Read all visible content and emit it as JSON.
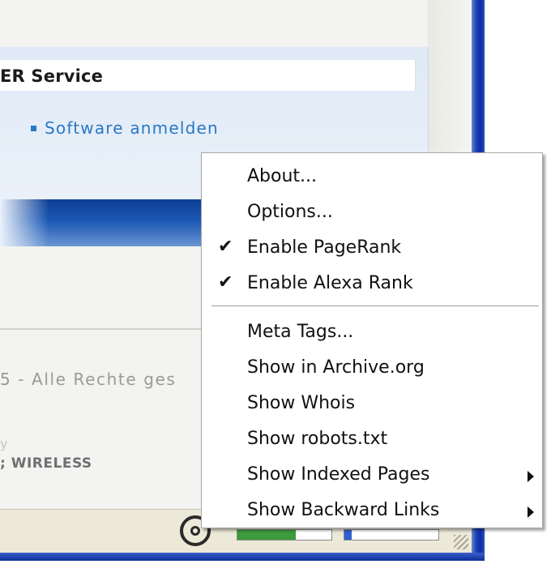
{
  "page": {
    "service_header": "ER Service",
    "service_link": "Software anmelden",
    "copyright": "5 - Alle Rechte ges",
    "by_text": "y",
    "wireless_logo": "; WIRELESS"
  },
  "status_bar": {
    "pagerank_level": 0.62,
    "alexa_level": 0.08
  },
  "context_menu": {
    "items": [
      {
        "label": "About...",
        "checked": false,
        "submenu": false
      },
      {
        "label": "Options...",
        "checked": false,
        "submenu": false
      },
      {
        "label": "Enable PageRank",
        "checked": true,
        "submenu": false
      },
      {
        "label": "Enable Alexa Rank",
        "checked": true,
        "submenu": false
      },
      {
        "label": "Meta Tags...",
        "checked": false,
        "submenu": false
      },
      {
        "label": "Show in Archive.org",
        "checked": false,
        "submenu": false
      },
      {
        "label": "Show Whois",
        "checked": false,
        "submenu": false
      },
      {
        "label": "Show robots.txt",
        "checked": false,
        "submenu": false
      },
      {
        "label": "Show Indexed Pages",
        "checked": false,
        "submenu": true
      },
      {
        "label": "Show Backward Links",
        "checked": false,
        "submenu": true
      }
    ],
    "check_glyph": "✔"
  },
  "colors": {
    "link_blue": "#2a78c4",
    "bar_blue": "#1b57b3",
    "pagerank_green": "#3c9c3c",
    "window_border_blue": "#0a2fa5"
  }
}
